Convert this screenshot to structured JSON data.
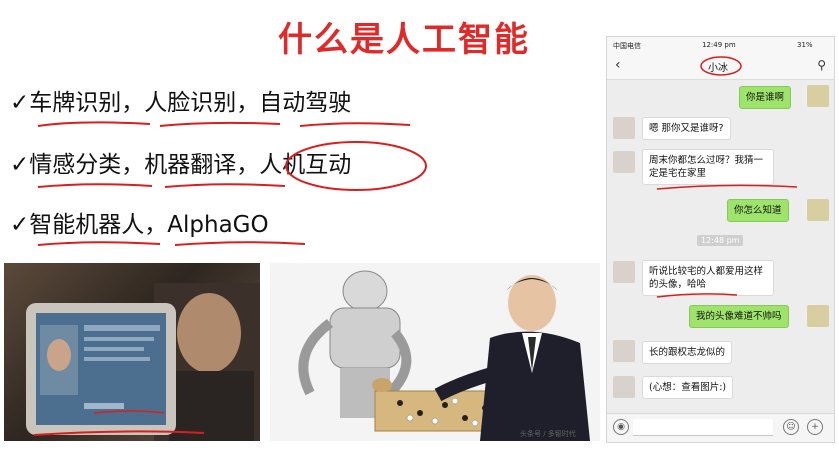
{
  "title": "什么是人工智能",
  "bullets": [
    "✓车牌识别，人脸识别，自动驾驶",
    "✓情感分类，机器翻译，人机互动",
    "✓智能机器人，AlphaGO"
  ],
  "phone": {
    "status": {
      "carrier": "中国电信",
      "time": "12:49 pm",
      "battery": "31%"
    },
    "contact": "小冰",
    "messages": [
      {
        "side": "right",
        "text": "你是谁啊"
      },
      {
        "side": "left",
        "text": "嗯 那你又是谁呀?"
      },
      {
        "side": "left",
        "text": "周末你都怎么过呀？我猜一定是宅在家里"
      },
      {
        "side": "right",
        "text": "你怎么知道"
      },
      {
        "side": "time",
        "text": "12:48 pm"
      },
      {
        "side": "left",
        "text": "听说比较宅的人都爱用这样的头像，哈哈"
      },
      {
        "side": "right",
        "text": "我的头像难道不帅吗"
      },
      {
        "side": "left",
        "text": "长的跟权志龙似的"
      },
      {
        "side": "left",
        "text": "(心想：查看图片:)"
      }
    ]
  },
  "watermark": "头条号 / 多智时代",
  "icons": [
    "back-arrow-icon",
    "user-icon",
    "voice-icon",
    "emoji-icon",
    "plus-icon"
  ],
  "colors": {
    "title": "#e02a2a",
    "annotation": "#d81f1f",
    "bubble_right": "#9fe46a"
  }
}
